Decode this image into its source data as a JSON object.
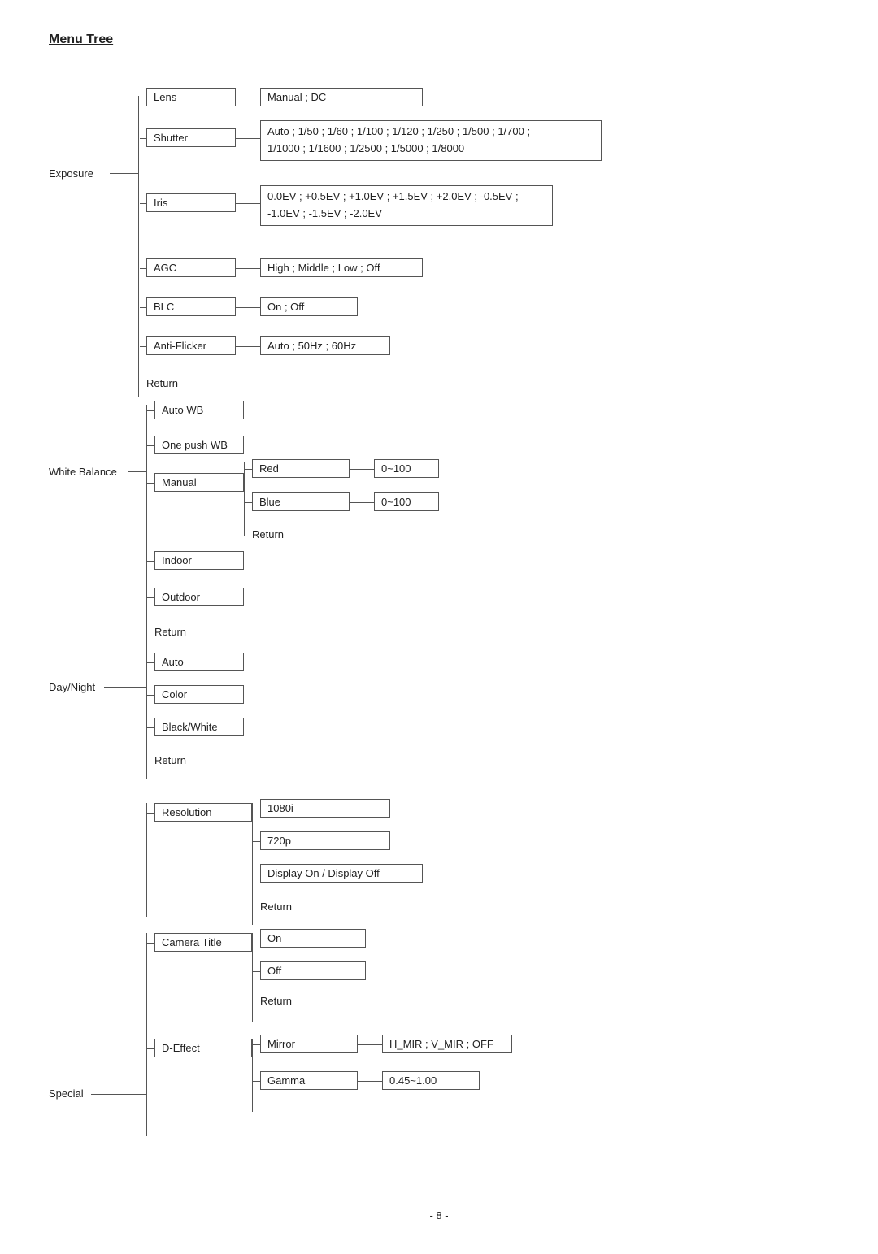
{
  "title": "Menu Tree",
  "pageNum": "- 8 -",
  "nodes": {
    "exposure": "Exposure",
    "lens": "Lens",
    "lensOptions": "Manual ; DC",
    "shutter": "Shutter",
    "shutterOptions": "Auto ; 1/50 ; 1/60 ; 1/100 ; 1/120 ; 1/250 ; 1/500 ; 1/700 ;",
    "shutterOptions2": "1/1000 ; 1/1600 ; 1/2500 ; 1/5000 ; 1/8000",
    "iris": "Iris",
    "irisOptions": "0.0EV ; +0.5EV ; +1.0EV ; +1.5EV ; +2.0EV ; -0.5EV ;",
    "irisOptions2": "-1.0EV ; -1.5EV ; -2.0EV",
    "agc": "AGC",
    "agcOptions": "High ; Middle ; Low ; Off",
    "blc": "BLC",
    "blcOptions": "On ; Off",
    "antiFlicker": "Anti-Flicker",
    "antiFlickerOptions": "Auto ; 50Hz ; 60Hz",
    "returnExposure": "Return",
    "whiteBalance": "White Balance",
    "autoWB": "Auto WB",
    "onePushWB": "One push WB",
    "manual": "Manual",
    "red": "Red",
    "redOptions": "0~100",
    "blue": "Blue",
    "blueOptions": "0~100",
    "returnManual": "Return",
    "indoor": "Indoor",
    "outdoor": "Outdoor",
    "returnWB": "Return",
    "dayNight": "Day/Night",
    "auto": "Auto",
    "color": "Color",
    "blackWhite": "Black/White",
    "returnDN": "Return",
    "special": "Special",
    "resolution": "Resolution",
    "r1080i": "1080i",
    "r720p": "720p",
    "displayOnOff": "Display On / Display Off",
    "returnResolution": "Return",
    "cameraTitle": "Camera Title",
    "ctOn": "On",
    "ctOff": "Off",
    "returnCT": "Return",
    "dEffect": "D-Effect",
    "mirror": "Mirror",
    "mirrorOptions": "H_MIR ; V_MIR ; OFF",
    "gamma": "Gamma",
    "gammaOptions": "0.45~1.00"
  }
}
